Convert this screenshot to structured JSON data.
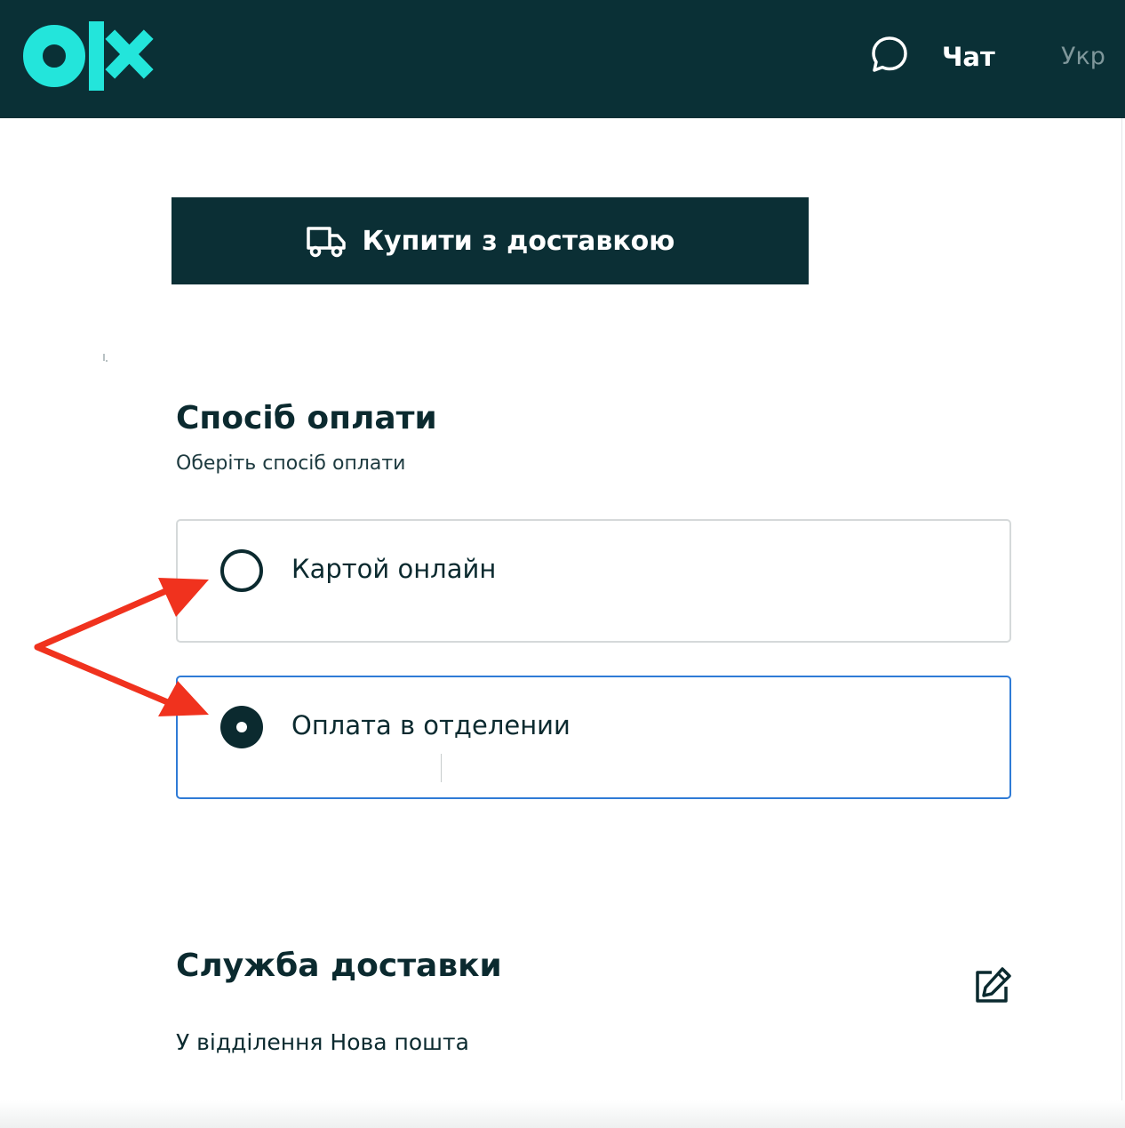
{
  "header": {
    "logo_icon": "olx-logo",
    "chat_icon": "chat-bubble-icon",
    "chat_label": "Чат",
    "language_label": "Укр"
  },
  "buy_button": {
    "icon": "truck-icon",
    "label": "Купити з доставкою"
  },
  "payment": {
    "title": "Спосіб оплати",
    "subtitle": "Оберіть спосіб оплати",
    "options": [
      {
        "label": "Картой онлайн",
        "selected": false
      },
      {
        "label": "Оплата в отделении",
        "selected": true
      }
    ]
  },
  "delivery": {
    "title": "Служба доставки",
    "value": "У відділення Нова пошта",
    "edit_icon": "edit-icon"
  },
  "colors": {
    "header_bg": "#0a3036",
    "brand_teal": "#23e5db",
    "button_bg": "#0b2f35",
    "selected_border": "#2f7bd6",
    "annotation_arrow": "#f0321e"
  }
}
